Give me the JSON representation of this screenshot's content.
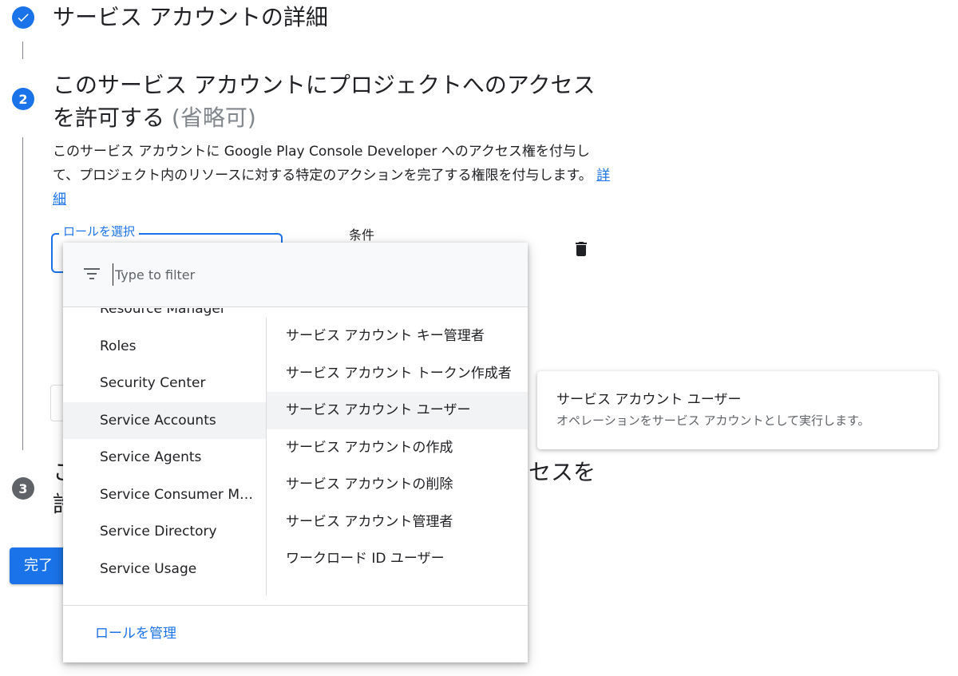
{
  "steps": {
    "step1": {
      "title": "サービス アカウントの詳細"
    },
    "step2": {
      "number": "2",
      "title": "このサービス アカウントにプロジェクトへのアクセスを許可する",
      "optional": "(省略可)",
      "description": "このサービス アカウントに Google Play Console Developer へのアクセス権を付与して、プロジェクト内のリソースに対する特定のアクションを完了する権限を付与します。",
      "learn_more": "詳細"
    },
    "step3": {
      "number": "3",
      "fragment_a": "こ",
      "fragment_b": "許",
      "fragment_c": "セスを"
    }
  },
  "role_field": {
    "label": "ロールを選択"
  },
  "condition": {
    "label": "条件"
  },
  "done_button": {
    "label": "完了"
  },
  "dropdown": {
    "filter_placeholder": "Type to filter",
    "categories": [
      {
        "label": "Resource Manager"
      },
      {
        "label": "Roles"
      },
      {
        "label": "Security Center"
      },
      {
        "label": "Service Accounts"
      },
      {
        "label": "Service Agents"
      },
      {
        "label": "Service Consumer Management"
      },
      {
        "label": "Service Directory"
      },
      {
        "label": "Service Usage"
      }
    ],
    "selected_category": "Service Accounts",
    "roles": [
      {
        "label": "サービス アカウント キー管理者"
      },
      {
        "label": "サービス アカウント トークン作成者"
      },
      {
        "label": "サービス アカウント ユーザー"
      },
      {
        "label": "サービス アカウントの作成"
      },
      {
        "label": "サービス アカウントの削除"
      },
      {
        "label": "サービス アカウント管理者"
      },
      {
        "label": "ワークロード ID ユーザー"
      }
    ],
    "selected_role": "サービス アカウント ユーザー",
    "manage_roles": "ロールを管理"
  },
  "tooltip": {
    "title": "サービス アカウント ユーザー",
    "description": "オペレーションをサービス アカウントとして実行します。"
  },
  "colors": {
    "accent": "#1a73e8",
    "text": "#202124",
    "secondary_text": "#5f6368",
    "selected_bg": "#f1f3f4"
  }
}
